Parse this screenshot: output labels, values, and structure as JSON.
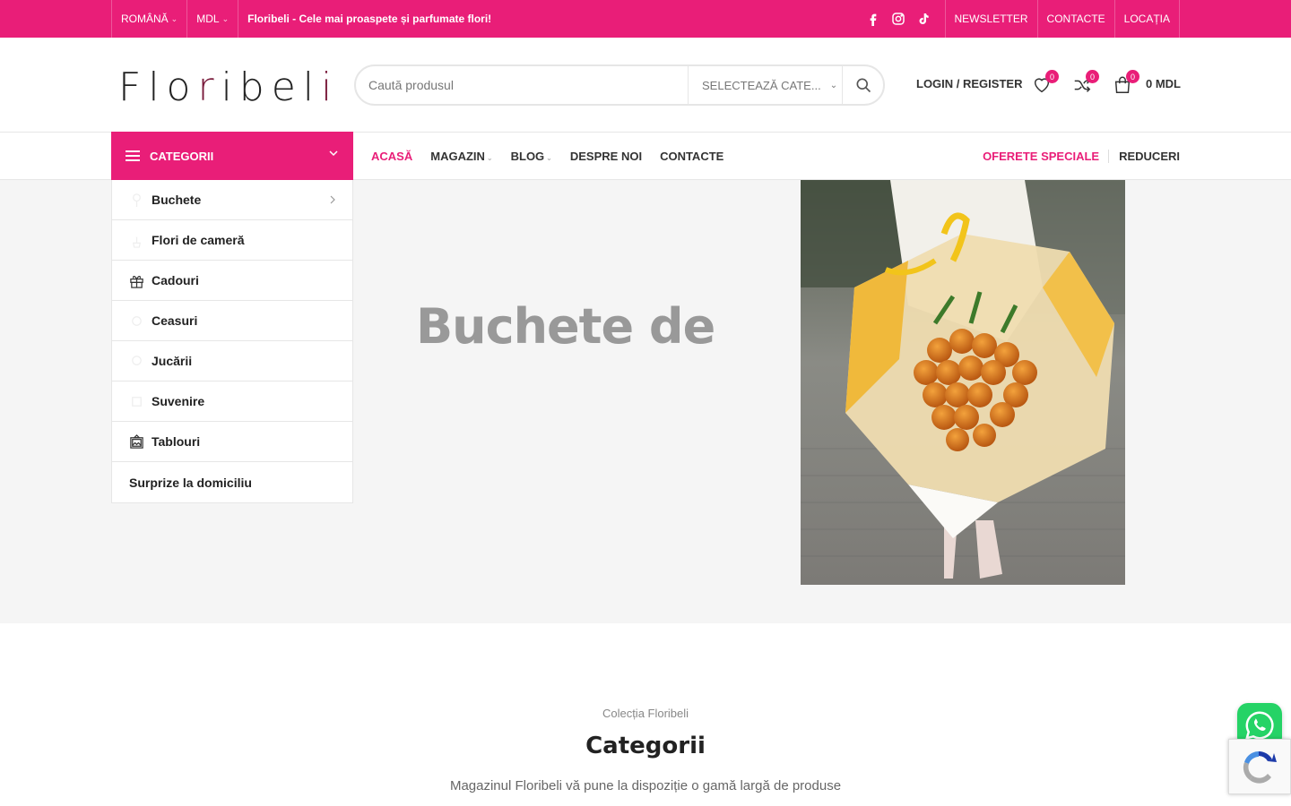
{
  "topbar": {
    "language": "ROMÂNĂ",
    "currency": "MDL",
    "promo": "Floribeli - Cele mai proaspete și parfumate flori!",
    "links": [
      "NEWSLETTER",
      "CONTACTE",
      "LOCAȚIA"
    ],
    "social_icons": [
      "facebook-icon",
      "instagram-icon",
      "tiktok-icon"
    ],
    "bg_color": "#e91e78"
  },
  "header": {
    "logo_text": "Floribeli",
    "search_placeholder": "Caută produsul",
    "search_category": "SELECTEAZĂ CATE...",
    "login_label": "LOGIN / REGISTER",
    "wishlist_count": "0",
    "compare_count": "0",
    "cart_count": "0",
    "cart_total": "0 MDL"
  },
  "nav": {
    "categories_label": "CATEGORII",
    "items": [
      {
        "label": "ACASĂ",
        "active": true
      },
      {
        "label": "MAGAZIN",
        "dropdown": true
      },
      {
        "label": "BLOG",
        "dropdown": true
      },
      {
        "label": "DESPRE NOI"
      },
      {
        "label": "CONTACTE"
      }
    ],
    "special_offers": "OFERETE SPECIALE",
    "discounts": "REDUCERI"
  },
  "categories": [
    {
      "label": "Buchete",
      "icon": "bouquet-icon",
      "submenu": true
    },
    {
      "label": "Flori de cameră",
      "icon": "plant-icon"
    },
    {
      "label": "Cadouri",
      "icon": "gift-icon"
    },
    {
      "label": "Ceasuri",
      "icon": "watch-icon"
    },
    {
      "label": "Jucării",
      "icon": "toy-icon"
    },
    {
      "label": "Suvenire",
      "icon": "souvenir-icon"
    },
    {
      "label": "Tablouri",
      "icon": "painting-icon"
    },
    {
      "label": "Surprize la domiciliu"
    }
  ],
  "hero": {
    "title": "Buchete de"
  },
  "section": {
    "subtitle": "Colecția Floribeli",
    "title": "Categorii",
    "description": "Magazinul Floribeli vă pune la dispoziție o gamă largă de produse"
  },
  "accent_color": "#e91e78"
}
